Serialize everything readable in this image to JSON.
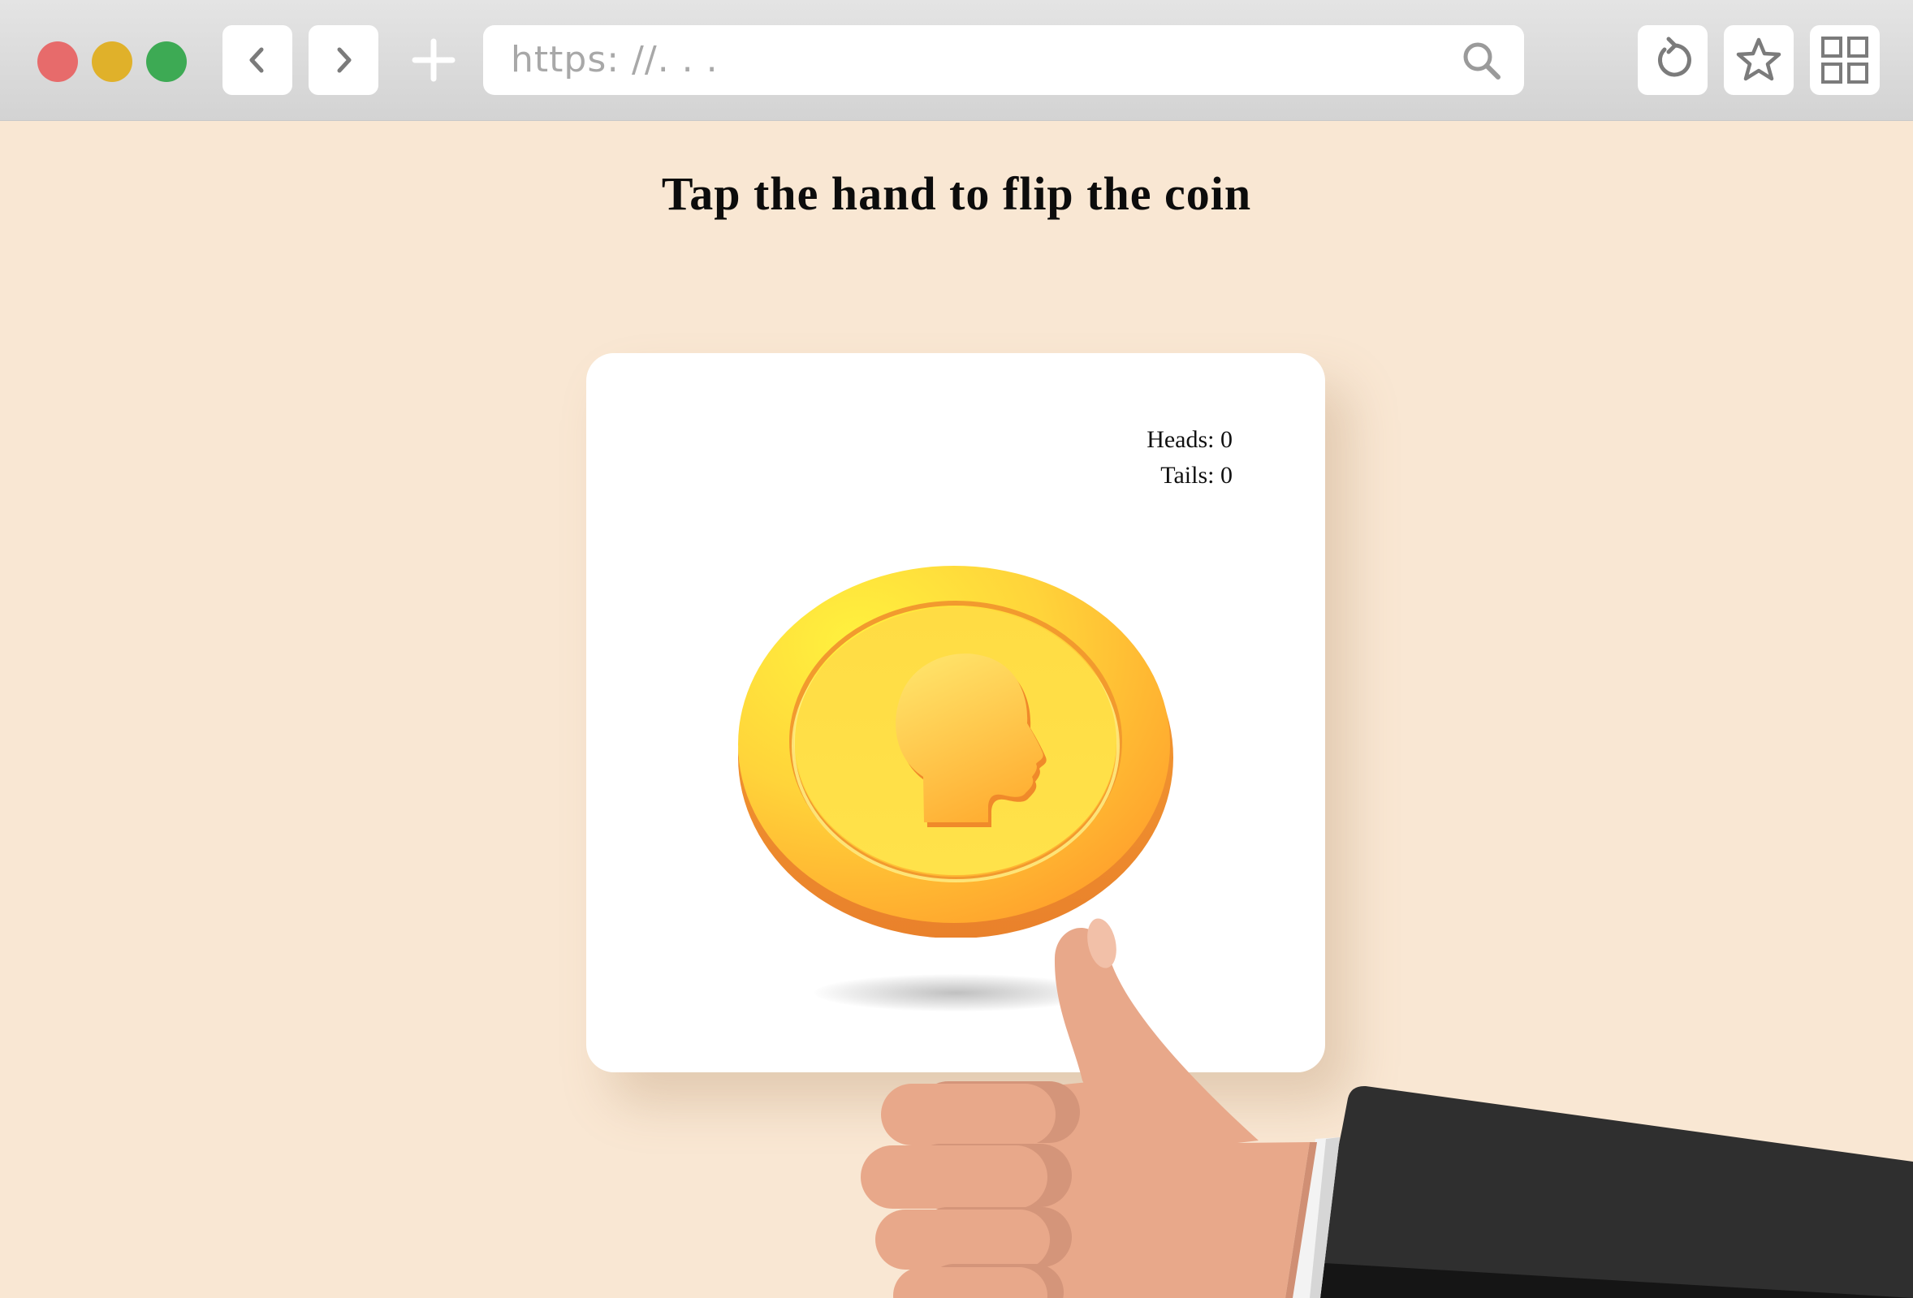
{
  "browser": {
    "url_placeholder": "https: //. . .",
    "traffic_colors": {
      "close": "#e76b6b",
      "minimize": "#e0b12a",
      "maximize": "#3daa54"
    }
  },
  "page": {
    "title": "Tap the hand to flip the coin",
    "scoreboard": {
      "heads_label": "Heads: 0",
      "tails_label": "Tails: 0"
    },
    "coin": {
      "face": "heads",
      "color": "#ffcf2e"
    },
    "hand": {
      "pose": "thumbs-up",
      "skin_color": "#e8a88a",
      "sleeve_color": "#2f2f2f"
    }
  },
  "colors": {
    "page_background": "#f9e7d3",
    "card_background": "#ffffff"
  }
}
